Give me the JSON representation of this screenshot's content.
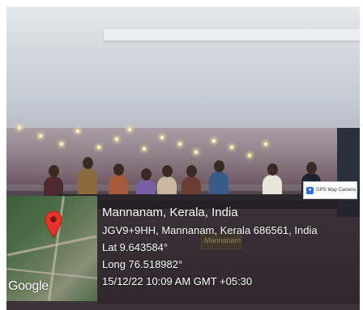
{
  "camera_badge": {
    "label": "GPS Map Camera",
    "icon": "camera-icon"
  },
  "name_plate": {
    "text": "Mannanam"
  },
  "map": {
    "attribution": "Google",
    "pin_icon": "location-pin-icon",
    "pin_color": "#e2352f"
  },
  "location": {
    "place": "Mannanam, Kerala, India",
    "address": "JGV9+9HH, Mannanam, Kerala 686561, India",
    "latitude": "Lat 9.643584°",
    "longitude": "Long 76.518982°",
    "datetime": "15/12/22 10:09 AM GMT +05:30"
  }
}
